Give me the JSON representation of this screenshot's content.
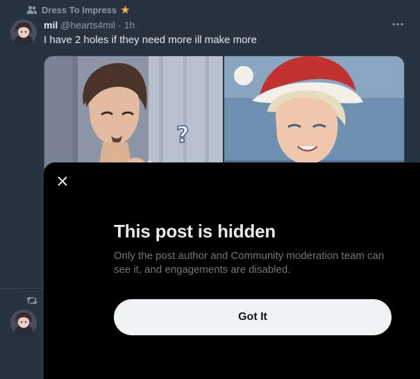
{
  "community": {
    "name": "Dress To Impress",
    "icon": "community-people-icon",
    "badge": "star"
  },
  "post": {
    "author_name": "mil",
    "handle": "@hearts4mil",
    "separator": "·",
    "time": "1h",
    "text": "I have 2 holes if they need more ill make more",
    "more_icon": "more-dots-icon",
    "media": [
      {
        "description_icon": "question-mark",
        "question_mark": "?"
      },
      {
        "description_icon": "santa-character"
      }
    ]
  },
  "next_post": {
    "repost_icon": "repost-icon"
  },
  "hidden_sheet": {
    "title": "This post is hidden",
    "description": "Only the post author and Community moderation team can see it, and engagements are disabled.",
    "button_label": "Got It",
    "close_icon": "close-icon"
  },
  "colors": {
    "background": "#273340",
    "sheet": "#000000",
    "primary_text": "#e7e9ea",
    "secondary_text": "#71767b",
    "button_bg": "#eff3f4",
    "button_text": "#0f1419",
    "star": "#f6b93b"
  }
}
